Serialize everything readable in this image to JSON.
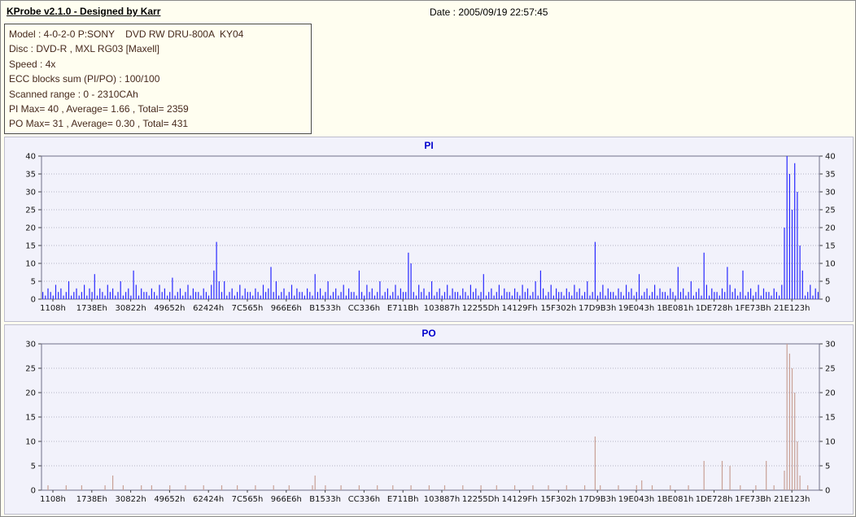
{
  "window": {
    "title": "KProbe v2.1.0 - Designed by Karr",
    "date_label": "Date : 2005/09/19 22:57:45"
  },
  "info": {
    "lines": [
      "Model : 4-0-2-0 P:SONY    DVD RW DRU-800A  KY04",
      "Disc : DVD-R , MXL RG03 [Maxell]",
      "Speed : 4x",
      "ECC blocks sum (PI/PO) : 100/100",
      "Scanned range : 0 - 2310CAh",
      "PI Max= 40 , Average= 1.66 , Total= 2359",
      "PO Max= 31 , Average= 0.30 , Total= 431"
    ]
  },
  "colors": {
    "pi_bars": "#2828ff",
    "po_bars": "#c8a096",
    "chart_title_blue": "#0000cd",
    "panel_background": "#f2f2fb",
    "window_background": "#fffef0"
  },
  "chart_data": [
    {
      "type": "bar",
      "title": "PI",
      "color": "#2828ff",
      "ylim": [
        0,
        40
      ],
      "yticks": [
        0,
        5,
        10,
        15,
        20,
        25,
        30,
        35,
        40
      ],
      "grid": "horizontal-dotted",
      "legend": "none",
      "x_labels": [
        "1108h",
        "1738Eh",
        "30822h",
        "49652h",
        "62424h",
        "7C565h",
        "966E6h",
        "B1533h",
        "CC336h",
        "E711Bh",
        "103887h",
        "12255Dh",
        "14129Fh",
        "15F302h",
        "17D9B3h",
        "19E043h",
        "1BE081h",
        "1DE728h",
        "1FE73Bh",
        "21E123h"
      ],
      "values": [
        2,
        1,
        3,
        2,
        1,
        4,
        2,
        3,
        1,
        2,
        5,
        1,
        2,
        3,
        1,
        2,
        4,
        1,
        3,
        2,
        7,
        1,
        3,
        2,
        1,
        4,
        2,
        3,
        1,
        2,
        5,
        1,
        2,
        3,
        1,
        8,
        4,
        1,
        3,
        2,
        2,
        1,
        3,
        2,
        1,
        4,
        2,
        3,
        1,
        2,
        6,
        1,
        2,
        3,
        1,
        2,
        4,
        1,
        3,
        2,
        2,
        1,
        3,
        2,
        1,
        4,
        8,
        16,
        5,
        2,
        5,
        1,
        2,
        3,
        1,
        2,
        4,
        1,
        3,
        2,
        2,
        1,
        3,
        2,
        1,
        4,
        2,
        3,
        9,
        2,
        5,
        1,
        2,
        3,
        1,
        2,
        4,
        1,
        3,
        2,
        2,
        1,
        3,
        2,
        1,
        7,
        2,
        3,
        1,
        2,
        5,
        1,
        2,
        3,
        1,
        2,
        4,
        1,
        3,
        2,
        2,
        1,
        8,
        2,
        1,
        4,
        2,
        3,
        1,
        2,
        5,
        1,
        2,
        3,
        1,
        2,
        4,
        1,
        3,
        2,
        2,
        13,
        10,
        2,
        1,
        4,
        2,
        3,
        1,
        2,
        5,
        1,
        2,
        3,
        1,
        2,
        4,
        1,
        3,
        2,
        2,
        1,
        3,
        2,
        1,
        4,
        2,
        3,
        1,
        2,
        7,
        1,
        2,
        3,
        1,
        2,
        4,
        1,
        3,
        2,
        2,
        1,
        3,
        2,
        1,
        4,
        2,
        3,
        1,
        2,
        5,
        1,
        8,
        3,
        1,
        2,
        4,
        1,
        3,
        2,
        2,
        1,
        3,
        2,
        1,
        4,
        2,
        3,
        1,
        2,
        5,
        1,
        2,
        16,
        1,
        2,
        4,
        1,
        3,
        2,
        2,
        1,
        3,
        2,
        1,
        4,
        2,
        3,
        1,
        2,
        7,
        1,
        2,
        3,
        1,
        2,
        4,
        1,
        3,
        2,
        2,
        1,
        3,
        2,
        1,
        9,
        2,
        3,
        1,
        2,
        5,
        1,
        2,
        3,
        1,
        13,
        4,
        1,
        3,
        2,
        2,
        1,
        3,
        2,
        9,
        4,
        2,
        3,
        1,
        2,
        8,
        1,
        2,
        3,
        1,
        2,
        4,
        1,
        3,
        2,
        2,
        1,
        3,
        2,
        1,
        4,
        20,
        40,
        35,
        25,
        38,
        30,
        15,
        8,
        1,
        2,
        4,
        1,
        3,
        2
      ]
    },
    {
      "type": "bar",
      "title": "PO",
      "color": "#c8a096",
      "ylim": [
        0,
        30
      ],
      "yticks": [
        0,
        5,
        10,
        15,
        20,
        25,
        30
      ],
      "grid": "horizontal-dotted",
      "legend": "none",
      "x_labels": [
        "1108h",
        "1738Eh",
        "30822h",
        "49652h",
        "62424h",
        "7C565h",
        "966E6h",
        "B1533h",
        "CC336h",
        "E711Bh",
        "103887h",
        "12255Dh",
        "14129Fh",
        "15F302h",
        "17D9B3h",
        "19E043h",
        "1BE081h",
        "1DE728h",
        "1FE73Bh",
        "21E123h"
      ],
      "values": [
        0,
        0,
        1,
        0,
        0,
        0,
        0,
        0,
        0,
        1,
        0,
        0,
        0,
        0,
        0,
        1,
        0,
        0,
        0,
        0,
        0,
        0,
        0,
        0,
        1,
        0,
        0,
        3,
        0,
        0,
        0,
        1,
        0,
        0,
        0,
        0,
        0,
        0,
        1,
        0,
        0,
        0,
        1,
        0,
        0,
        0,
        0,
        0,
        0,
        1,
        0,
        0,
        0,
        0,
        0,
        1,
        0,
        0,
        0,
        0,
        0,
        0,
        1,
        0,
        0,
        0,
        0,
        0,
        0,
        1,
        0,
        0,
        0,
        0,
        0,
        1,
        0,
        0,
        0,
        0,
        0,
        0,
        1,
        0,
        0,
        0,
        0,
        0,
        0,
        1,
        0,
        0,
        0,
        0,
        0,
        1,
        0,
        0,
        0,
        0,
        0,
        0,
        0,
        0,
        1,
        3,
        0,
        0,
        0,
        1,
        0,
        0,
        0,
        0,
        0,
        1,
        0,
        0,
        0,
        0,
        0,
        0,
        1,
        0,
        0,
        0,
        0,
        0,
        0,
        1,
        0,
        0,
        0,
        0,
        0,
        1,
        0,
        0,
        0,
        0,
        0,
        0,
        1,
        0,
        0,
        0,
        0,
        0,
        0,
        1,
        0,
        0,
        0,
        0,
        0,
        1,
        0,
        0,
        0,
        0,
        0,
        0,
        1,
        0,
        0,
        0,
        0,
        0,
        0,
        1,
        0,
        0,
        0,
        0,
        0,
        1,
        0,
        0,
        0,
        0,
        0,
        0,
        1,
        0,
        0,
        0,
        0,
        0,
        0,
        1,
        0,
        0,
        0,
        0,
        0,
        1,
        0,
        0,
        0,
        0,
        0,
        0,
        1,
        0,
        0,
        0,
        0,
        0,
        0,
        1,
        0,
        0,
        0,
        11,
        0,
        1,
        0,
        0,
        0,
        0,
        0,
        0,
        1,
        0,
        0,
        0,
        0,
        0,
        0,
        1,
        0,
        2,
        0,
        0,
        0,
        1,
        0,
        0,
        0,
        0,
        0,
        0,
        1,
        0,
        0,
        0,
        0,
        0,
        0,
        1,
        0,
        0,
        0,
        0,
        0,
        6,
        0,
        0,
        0,
        0,
        0,
        0,
        6,
        0,
        0,
        5,
        0,
        0,
        0,
        1,
        0,
        0,
        0,
        0,
        0,
        1,
        0,
        0,
        0,
        6,
        0,
        0,
        1,
        0,
        0,
        0,
        4,
        30,
        28,
        25,
        20,
        10,
        3,
        0,
        0,
        1,
        0,
        0,
        0,
        0
      ]
    }
  ]
}
